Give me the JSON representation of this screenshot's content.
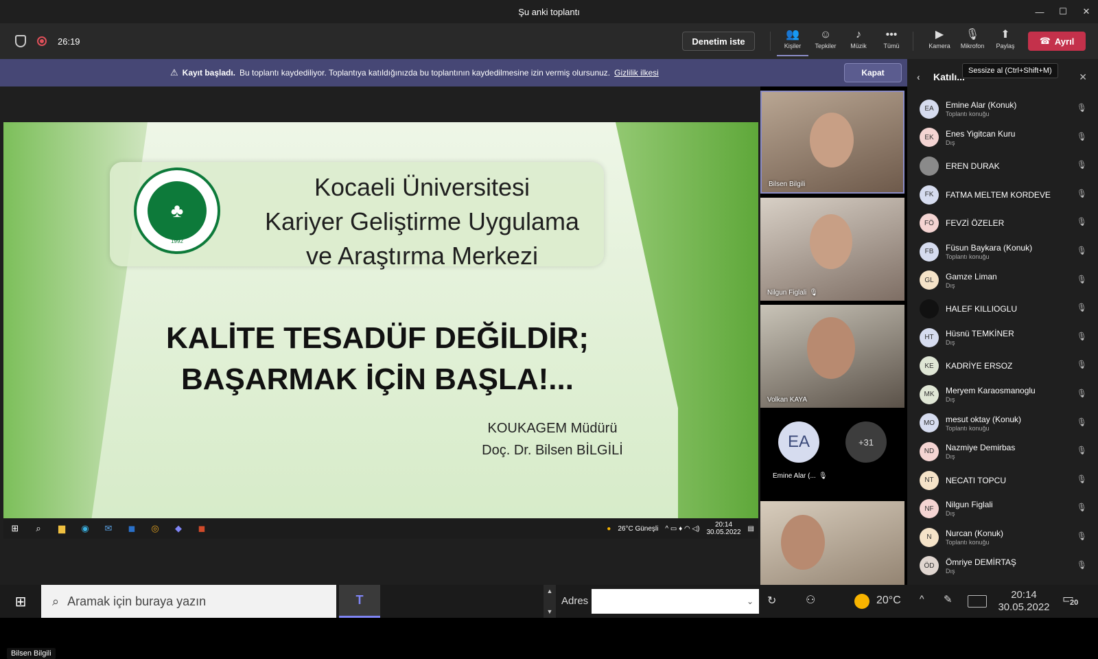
{
  "window": {
    "title": "Şu anki toplantı",
    "minimize": "—",
    "maximize": "☐",
    "close": "✕"
  },
  "toolbar": {
    "timer": "26:19",
    "request_control": "Denetim iste",
    "people": "Kişiler",
    "reactions": "Tepkiler",
    "music": "Müzik",
    "more": "Tümü",
    "camera": "Kamera",
    "mic": "Mikrofon",
    "share": "Paylaş",
    "leave": "Ayrıl"
  },
  "banner": {
    "title": "Kayıt başladı.",
    "message": "Bu toplantı kaydediliyor. Toplantıya katıldığınızda bu toplantının kaydedilmesine izin vermiş olursunuz.",
    "link": "Gizlilik ilkesi",
    "close": "Kapat"
  },
  "slide": {
    "logo_year": "1992",
    "university_lines": [
      "Kocaeli Üniversitesi",
      "Kariyer Geliştirme Uygulama",
      "ve Araştırma Merkezi"
    ],
    "slogan_lines": [
      "KALİTE TESADÜF DEĞİLDİR;",
      "BAŞARMAK İÇİN BAŞLA!..."
    ],
    "signature_lines": [
      "KOUKAGEM Müdürü",
      "Doç. Dr. Bilsen BİLGİLİ"
    ]
  },
  "inner_taskbar": {
    "weather": "26°C  Güneşli",
    "time": "20:14",
    "date": "30.05.2022"
  },
  "presenter_label": "Bilsen Bilgili",
  "video_tiles": [
    {
      "name": "Bilsen Bilgili"
    },
    {
      "name": "Nilgun Figlali"
    },
    {
      "name": "Volkan KAYA"
    }
  ],
  "avatar_tile": {
    "initials": "EA",
    "more": "+31",
    "name": "Emine Alar (..."
  },
  "panel": {
    "title": "Katılı...",
    "tooltip": "Sessize al (Ctrl+Shift+M)",
    "participants": [
      {
        "initials": "EA",
        "name": "Emine Alar (Konuk)",
        "role": "Toplantı konuğu",
        "color": "#d6dcef"
      },
      {
        "initials": "EK",
        "name": "Enes Yigitcan Kuru",
        "role": "Dış",
        "color": "#f4d4d2"
      },
      {
        "initials": "",
        "name": "EREN DURAK",
        "role": "",
        "color": "#8a8a8a"
      },
      {
        "initials": "FK",
        "name": "FATMA MELTEM KORDEVE",
        "role": "",
        "color": "#d6dcef"
      },
      {
        "initials": "FÖ",
        "name": "FEVZİ ÖZELER",
        "role": "",
        "color": "#f4d4d2"
      },
      {
        "initials": "FB",
        "name": "Füsun Baykara (Konuk)",
        "role": "Toplantı konuğu",
        "color": "#d6dcef"
      },
      {
        "initials": "GL",
        "name": "Gamze Liman",
        "role": "Dış",
        "color": "#f5e3c8"
      },
      {
        "initials": "",
        "name": "HALEF KILLIOGLU",
        "role": "",
        "color": "#111111"
      },
      {
        "initials": "HT",
        "name": "Hüsnü TEMKİNER",
        "role": "Dış",
        "color": "#d6dcef"
      },
      {
        "initials": "KE",
        "name": "KADRİYE ERSOZ",
        "role": "",
        "color": "#dfe6d5"
      },
      {
        "initials": "MK",
        "name": "Meryem Karaosmanoglu",
        "role": "Dış",
        "color": "#dfe6d5"
      },
      {
        "initials": "MO",
        "name": "mesut oktay (Konuk)",
        "role": "Toplantı konuğu",
        "color": "#d6dcef"
      },
      {
        "initials": "ND",
        "name": "Nazmiye Demirbas",
        "role": "Dış",
        "color": "#f4d4d2"
      },
      {
        "initials": "NT",
        "name": "NECATI TOPCU",
        "role": "",
        "color": "#f5e3c8"
      },
      {
        "initials": "NF",
        "name": "Nilgun Figlali",
        "role": "Dış",
        "color": "#f4d4d2"
      },
      {
        "initials": "N",
        "name": "Nurcan (Konuk)",
        "role": "Toplantı konuğu",
        "color": "#f5e3c8"
      },
      {
        "initials": "ÖD",
        "name": "Ömriye DEMİRTAŞ",
        "role": "Dış",
        "color": "#e0d6d0"
      }
    ]
  },
  "taskbar": {
    "search_placeholder": "Aramak için buraya yazın",
    "address_label": "Adres",
    "temperature": "20°C",
    "time": "20:14",
    "date": "30.05.2022",
    "notifications": "20"
  }
}
